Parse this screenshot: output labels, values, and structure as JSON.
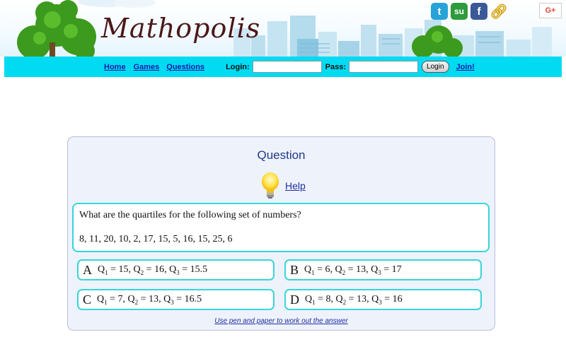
{
  "header": {
    "logo_text": "Mathopolis",
    "social_icons": [
      "twitter-icon",
      "stumbleupon-icon",
      "facebook-icon",
      "link-icon"
    ],
    "gplus_label": "G+"
  },
  "nav": {
    "links": [
      "Home",
      "Games",
      "Questions"
    ],
    "login_label": "Login:",
    "pass_label": "Pass:",
    "login_value": "",
    "pass_value": "",
    "login_button": "Login",
    "join_link": "Join!"
  },
  "question": {
    "title": "Question",
    "help_label": "Help",
    "prompt": "What are the quartiles for the following set of numbers?",
    "numbers": "8, 11, 20, 10, 2, 17, 15, 5, 16, 15, 25, 6",
    "answers": [
      {
        "letter": "A",
        "q1": "15",
        "q2": "16",
        "q3": "15.5"
      },
      {
        "letter": "B",
        "q1": "6",
        "q2": "13",
        "q3": "17"
      },
      {
        "letter": "C",
        "q1": "7",
        "q2": "13",
        "q3": "16.5"
      },
      {
        "letter": "D",
        "q1": "8",
        "q2": "13",
        "q3": "16"
      }
    ],
    "hint": "Use pen and paper to work out the answer"
  },
  "colors": {
    "nav_bar": "#00dbf2",
    "answer_border": "#36d6da",
    "card_bg": "#eef2fb",
    "title": "#1f3a88"
  }
}
